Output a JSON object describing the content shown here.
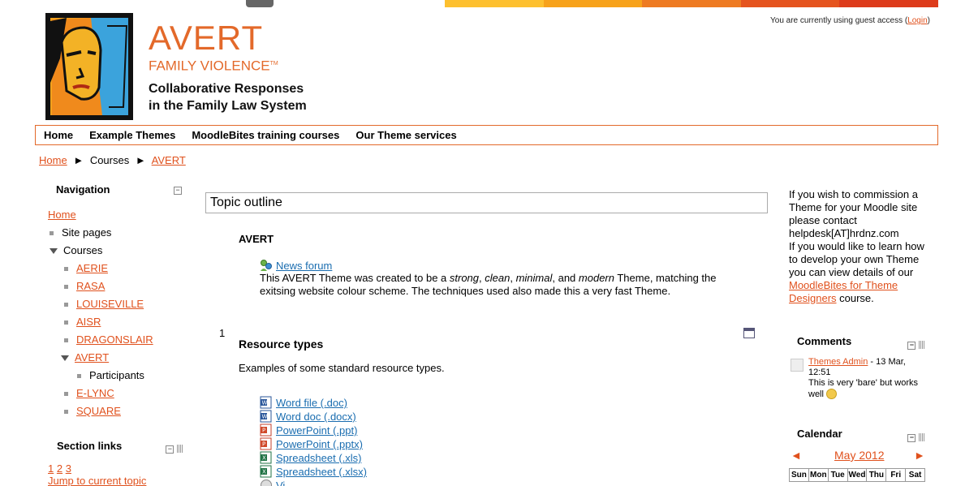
{
  "header": {
    "guest_prefix": "You are currently using guest access (",
    "login_label": "Login",
    "guest_suffix": ")",
    "brand_name": "AVERT",
    "brand_sub": "FAMILY VIOLENCE",
    "brand_tm": "TM",
    "tagline_1": "Collaborative Responses",
    "tagline_2": "in the Family Law System",
    "strip_colors": [
      "#fdc02f",
      "#f7a21b",
      "#ee7b22",
      "#e5541e",
      "#dd3b1b"
    ]
  },
  "menu": {
    "items": [
      "Home",
      "Example Themes",
      "MoodleBites training courses",
      "Our Theme services"
    ]
  },
  "breadcrumb": {
    "home": "Home",
    "courses": "Courses",
    "current": "AVERT",
    "sep": "►"
  },
  "navigation": {
    "title": "Navigation",
    "home": "Home",
    "site_pages": "Site pages",
    "courses": "Courses",
    "course_list": [
      "AERIE",
      "RASA",
      "LOUISEVILLE",
      "AISR",
      "DRAGONSLAIR"
    ],
    "current_course": "AVERT",
    "participants": "Participants",
    "course_list_after": [
      "E-LYNC",
      "SQUARE"
    ]
  },
  "section_links": {
    "title": "Section links",
    "numbers": [
      "1",
      "2",
      "3"
    ],
    "jump": "Jump to current topic"
  },
  "main": {
    "topic_outline": "Topic outline",
    "section0": {
      "title": "AVERT",
      "forum": "News forum",
      "summary_1": "This AVERT Theme was created to be a ",
      "em_1": "strong",
      "summary_2": ", ",
      "em_2": "clean",
      "summary_3": ", ",
      "em_3": "minimal",
      "summary_4": ", and ",
      "em_4": "modern",
      "summary_5": " Theme, matching the exitsing website colour scheme.  The techniques used also made this a very fast Theme."
    },
    "section1": {
      "number": "1",
      "title": "Resource types",
      "description": "Examples of some standard resource types.",
      "resources": [
        {
          "label": "Word file (.doc)",
          "icon": "word-icon"
        },
        {
          "label": "Word doc (.docx)",
          "icon": "word-icon"
        },
        {
          "label": "PowerPoint (.ppt)",
          "icon": "powerpoint-icon"
        },
        {
          "label": "PowerPoint (.pptx)",
          "icon": "powerpoint-icon"
        },
        {
          "label": "Spreadsheet (.xls)",
          "icon": "excel-icon"
        },
        {
          "label": "Spreadsheet (.xlsx)",
          "icon": "excel-icon"
        },
        {
          "label": "Vi...",
          "icon": "video-icon"
        }
      ]
    }
  },
  "right": {
    "commission_1": "If you wish to commission a Theme for your Moodle site please contact helpdesk[AT]hrdnz.com",
    "commission_2": "If you would like to learn how to develop your own Theme you can view details of our ",
    "commission_link": "MoodleBites for Theme Designers",
    "commission_3": " course.",
    "comments": {
      "title": "Comments",
      "author": "Themes Admin",
      "date": " - 13 Mar, 12:51",
      "text": "This is very 'bare' but works well"
    },
    "calendar": {
      "title": "Calendar",
      "prev": "◄",
      "month": "May 2012",
      "next": "►",
      "days": [
        "Sun",
        "Mon",
        "Tue",
        "Wed",
        "Thu",
        "Fri",
        "Sat"
      ]
    }
  }
}
